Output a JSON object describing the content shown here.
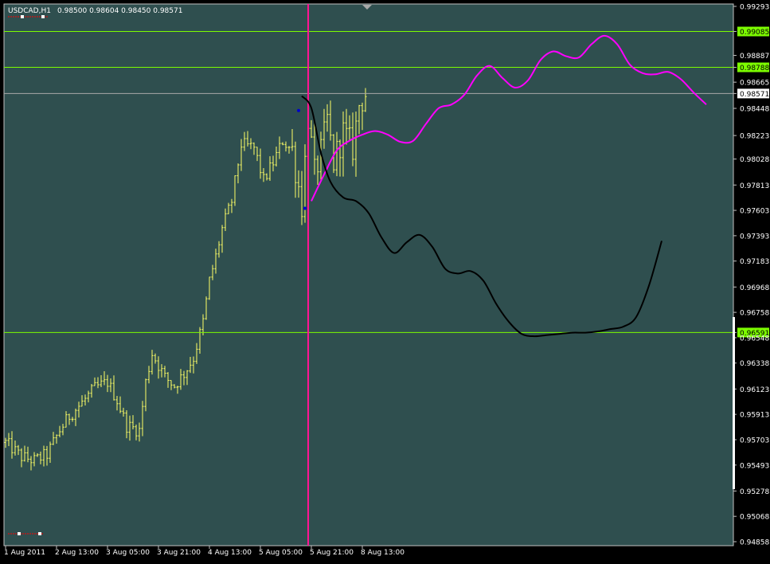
{
  "info": {
    "symbol": "USDCAD,H1",
    "ohlc": "0.98500 0.98604 0.98450 0.98571"
  },
  "colors": {
    "background": "#2f4f4f",
    "frame": "#000000",
    "candle": "#ffff66",
    "hline": "#7cfc00",
    "vline": "#ff1493",
    "current_price_line": "#a9a9a9",
    "projection_magenta": "#ff00ff",
    "projection_black": "#000000",
    "text": "#ffffff"
  },
  "chart_data": {
    "type": "candlestick",
    "symbol": "USDCAD",
    "timeframe": "H1",
    "ylim": [
      0.94858,
      0.99293
    ],
    "y_ticks": [
      "0.99293",
      "0.99085",
      "0.98887",
      "0.98788",
      "0.98665",
      "0.98571",
      "0.98448",
      "0.98223",
      "0.98028",
      "0.97813",
      "0.97603",
      "0.97393",
      "0.97183",
      "0.96968",
      "0.96758",
      "0.96591",
      "0.96548",
      "0.96338",
      "0.96123",
      "0.95913",
      "0.95703",
      "0.95493",
      "0.95278",
      "0.95068",
      "0.94858"
    ],
    "x_ticks": [
      "1 Aug 2011",
      "2 Aug 13:00",
      "3 Aug 05:00",
      "3 Aug 21:00",
      "4 Aug 13:00",
      "5 Aug 05:00",
      "5 Aug 21:00",
      "8 Aug 13:00"
    ],
    "x_tick_bar": [
      0,
      16,
      32,
      48,
      64,
      80,
      96,
      112
    ],
    "horizontal_levels": [
      {
        "price": "0.99085",
        "value": 0.99085
      },
      {
        "price": "0.98788",
        "value": 0.98788
      },
      {
        "price": "0.96591",
        "value": 0.96591
      }
    ],
    "current_price": {
      "price": "0.98571",
      "value": 0.98571
    },
    "vertical_line_bar": 95,
    "close_path": [
      [
        0,
        0.9568
      ],
      [
        5,
        0.9556
      ],
      [
        9,
        0.9553
      ],
      [
        13,
        0.9558
      ],
      [
        17,
        0.9578
      ],
      [
        20,
        0.959
      ],
      [
        24,
        0.9601
      ],
      [
        28,
        0.9613
      ],
      [
        32,
        0.9618
      ],
      [
        35,
        0.9603
      ],
      [
        38,
        0.9582
      ],
      [
        42,
        0.9578
      ],
      [
        44,
        0.9618
      ],
      [
        46,
        0.9642
      ],
      [
        50,
        0.9622
      ],
      [
        53,
        0.9615
      ],
      [
        56,
        0.9625
      ],
      [
        59,
        0.9638
      ],
      [
        62,
        0.9668
      ],
      [
        64,
        0.9702
      ],
      [
        66,
        0.9722
      ],
      [
        68,
        0.9745
      ],
      [
        71,
        0.9768
      ],
      [
        74,
        0.9815
      ],
      [
        78,
        0.9812
      ],
      [
        81,
        0.9785
      ],
      [
        84,
        0.98
      ],
      [
        87,
        0.9818
      ],
      [
        90,
        0.981
      ],
      [
        93,
        0.9765
      ],
      [
        95,
        0.9838
      ],
      [
        97,
        0.979
      ],
      [
        99,
        0.9808
      ],
      [
        101,
        0.9835
      ],
      [
        103,
        0.98
      ],
      [
        106,
        0.9825
      ],
      [
        109,
        0.9812
      ],
      [
        111,
        0.9848
      ],
      [
        113,
        0.9857
      ]
    ],
    "projection_magenta": [
      [
        96,
        0.9768
      ],
      [
        100,
        0.979
      ],
      [
        104,
        0.981
      ],
      [
        108,
        0.9818
      ],
      [
        112,
        0.9823
      ],
      [
        116,
        0.9826
      ],
      [
        120,
        0.9823
      ],
      [
        124,
        0.9817
      ],
      [
        128,
        0.9818
      ],
      [
        132,
        0.9832
      ],
      [
        136,
        0.9845
      ],
      [
        140,
        0.9848
      ],
      [
        144,
        0.9856
      ],
      [
        148,
        0.9872
      ],
      [
        152,
        0.988
      ],
      [
        156,
        0.987
      ],
      [
        160,
        0.9862
      ],
      [
        164,
        0.9868
      ],
      [
        168,
        0.9885
      ],
      [
        172,
        0.9892
      ],
      [
        176,
        0.9888
      ],
      [
        180,
        0.9887
      ],
      [
        184,
        0.9898
      ],
      [
        188,
        0.9905
      ],
      [
        192,
        0.9898
      ],
      [
        196,
        0.9881
      ],
      [
        200,
        0.9874
      ],
      [
        204,
        0.9873
      ],
      [
        208,
        0.9875
      ],
      [
        212,
        0.9869
      ],
      [
        216,
        0.9858
      ],
      [
        220,
        0.9848
      ]
    ],
    "projection_black": [
      [
        93,
        0.9855
      ],
      [
        96,
        0.9845
      ],
      [
        99,
        0.9808
      ],
      [
        102,
        0.9784
      ],
      [
        106,
        0.9771
      ],
      [
        110,
        0.9768
      ],
      [
        114,
        0.9758
      ],
      [
        118,
        0.9738
      ],
      [
        122,
        0.9725
      ],
      [
        126,
        0.9734
      ],
      [
        130,
        0.974
      ],
      [
        134,
        0.973
      ],
      [
        138,
        0.9712
      ],
      [
        142,
        0.9708
      ],
      [
        146,
        0.971
      ],
      [
        150,
        0.9702
      ],
      [
        154,
        0.9683
      ],
      [
        158,
        0.9668
      ],
      [
        162,
        0.9658
      ],
      [
        166,
        0.9656
      ],
      [
        170,
        0.9657
      ],
      [
        174,
        0.9658
      ],
      [
        178,
        0.9659
      ],
      [
        182,
        0.9659
      ],
      [
        186,
        0.966
      ],
      [
        190,
        0.9662
      ],
      [
        194,
        0.9664
      ],
      [
        198,
        0.9672
      ],
      [
        202,
        0.9698
      ],
      [
        206,
        0.9735
      ]
    ],
    "marker_points": [
      [
        92,
        0.9843
      ],
      [
        94,
        0.9762
      ]
    ]
  }
}
